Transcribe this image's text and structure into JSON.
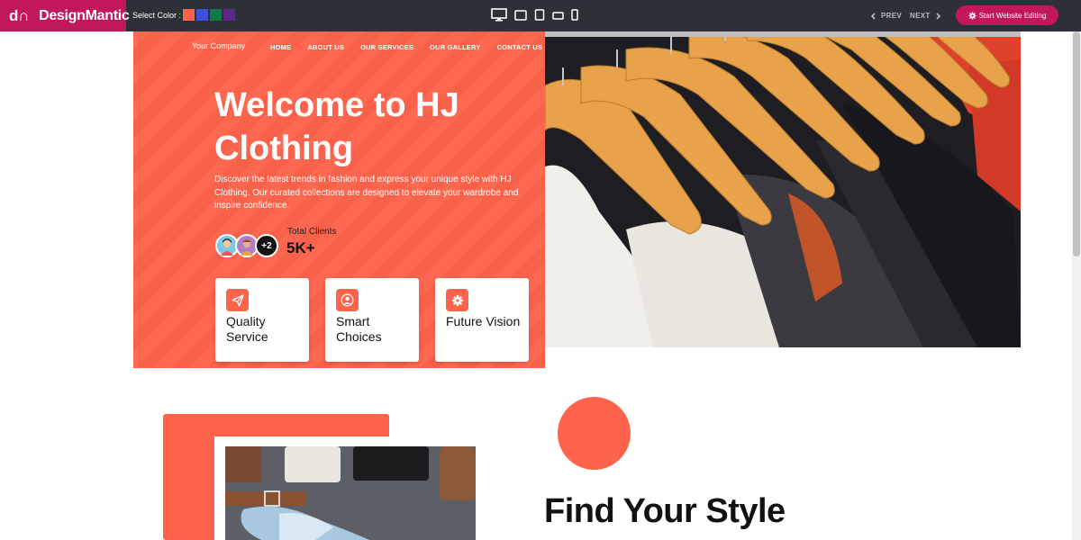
{
  "editor": {
    "logo_mark": "d∩",
    "logo_text": "DesignMantic",
    "select_color_label": "Select Color :",
    "swatches": [
      "#fe634b",
      "#3f51d8",
      "#0f7a4a",
      "#5b2a86"
    ],
    "devices": [
      "desktop-icon",
      "tablet-landscape-icon",
      "tablet-portrait-icon",
      "mobile-landscape-icon",
      "mobile-portrait-icon"
    ],
    "prev_label": "PREV",
    "next_label": "NEXT",
    "start_label": "Start Website Editing",
    "accent": "#c2185b"
  },
  "site": {
    "company": "Your Company",
    "nav": [
      "HOME",
      "ABOUT US",
      "OUR SERVICES",
      "OUR GALLERY",
      "CONTACT US"
    ],
    "hero_title": "Welcome to HJ Clothing",
    "hero_desc": "Discover the latest trends in fashion and express your unique style with HJ Clothing. Our curated collections are designed to elevate your wardrobe and inspire confidence.",
    "avatar_more": "+2",
    "clients_label": "Total Clients",
    "clients_value": "5K+",
    "cards": [
      {
        "label": "Quality Service",
        "icon": "paper-plane-icon"
      },
      {
        "label": "Smart Choices",
        "icon": "user-circle-icon"
      },
      {
        "label": "Future Vision",
        "icon": "gear-icon"
      }
    ],
    "section_title": "Find Your Style",
    "brand_color": "#fe634b"
  }
}
